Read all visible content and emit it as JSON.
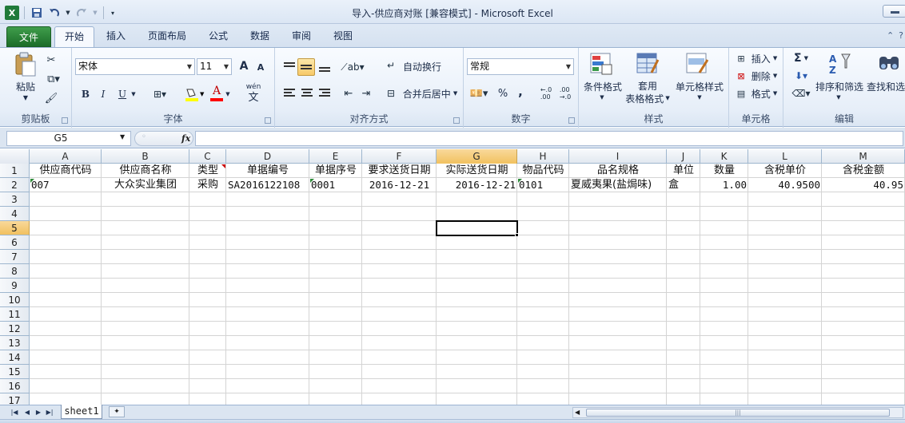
{
  "window": {
    "title": "导入-供应商对账  [兼容模式]  -  Microsoft Excel"
  },
  "tabs": [
    "文件",
    "开始",
    "插入",
    "页面布局",
    "公式",
    "数据",
    "审阅",
    "视图"
  ],
  "ribbon": {
    "clipboard": {
      "paste": "粘贴",
      "label": "剪贴板"
    },
    "font": {
      "name": "宋体",
      "size": "11",
      "label": "字体",
      "grow": "A",
      "shrink": "A",
      "bold": "B",
      "italic": "I",
      "underline": "U",
      "font_color": "A",
      "phonetic": "wén",
      "phonetic_char": "文"
    },
    "alignment": {
      "wrap": "自动换行",
      "merge": "合并后居中",
      "label": "对齐方式"
    },
    "number": {
      "format": "常规",
      "percent": "%",
      "comma": ",",
      "inc_decimal": "+.0\n.00",
      "dec_decimal": ".00\n+.0",
      "label": "数字"
    },
    "styles": {
      "conditional": "条件格式",
      "table_line1": "套用",
      "table_line2": "表格格式",
      "cell_styles": "单元格样式",
      "label": "样式"
    },
    "cells": {
      "insert": "插入",
      "delete": "删除",
      "format": "格式",
      "label": "单元格"
    },
    "editing": {
      "sort": "排序和筛选",
      "find": "查找和选",
      "label": "编辑",
      "sigma": "Σ"
    }
  },
  "formula_bar": {
    "name_box": "G5",
    "fx": "fx",
    "value": ""
  },
  "columns": [
    "A",
    "B",
    "C",
    "D",
    "E",
    "F",
    "G",
    "H",
    "I",
    "J",
    "K",
    "L",
    "M"
  ],
  "rows": [
    "1",
    "2",
    "3",
    "4",
    "5",
    "6",
    "7",
    "8",
    "9",
    "10",
    "11",
    "12",
    "13",
    "14",
    "15",
    "16",
    "17"
  ],
  "header_row": [
    "供应商代码",
    "供应商名称",
    "类型",
    "单据编号",
    "单据序号",
    "要求送货日期",
    "实际送货日期",
    "物品代码",
    "品名规格",
    "单位",
    "数量",
    "含税单价",
    "含税金额"
  ],
  "data_row": [
    "007",
    "大众实业集团",
    "采购",
    "SA2016122108",
    "0001",
    "2016-12-21",
    "2016-12-21",
    "0101",
    "夏威夷果(盐焗味)",
    "盒",
    "1.00",
    "40.9500",
    "40.95"
  ],
  "selected_cell": "G5",
  "sheet_tabs": [
    "sheet1"
  ],
  "colors": {
    "selected_header": "#f1c15f",
    "file_tab": "#2b8a37",
    "ribbon_bg": "#e6eef8"
  }
}
